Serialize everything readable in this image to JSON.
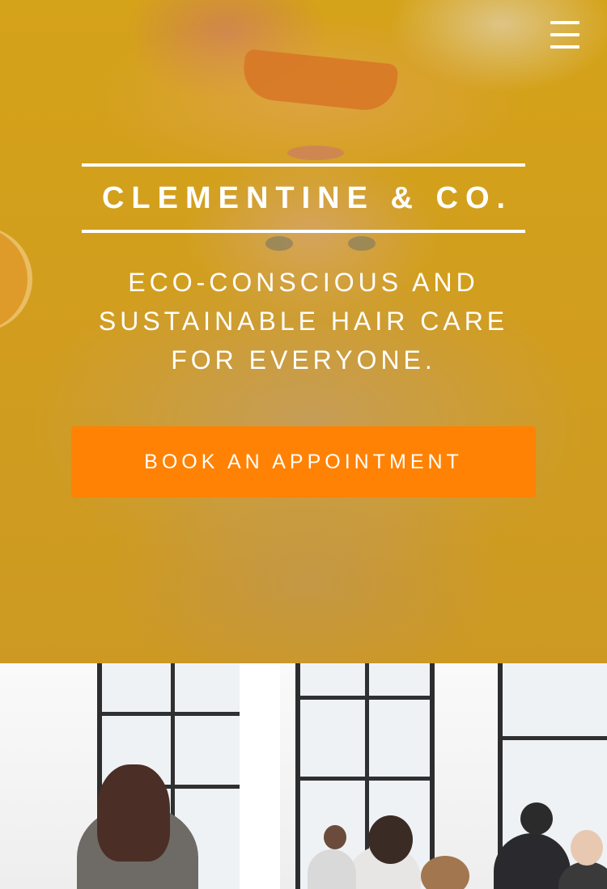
{
  "header": {
    "menu_icon": "hamburger-menu-icon"
  },
  "hero": {
    "brand": "CLEMENTINE & CO.",
    "tagline_lines": [
      "ECO-CONSCIOUS AND",
      "SUSTAINABLE HAIR CARE",
      "FOR EVERYONE."
    ],
    "cta_label": "BOOK AN APPOINTMENT"
  },
  "colors": {
    "hero_background": "#e3ad14",
    "cta_background": "#ff8205",
    "text": "#ffffff"
  }
}
